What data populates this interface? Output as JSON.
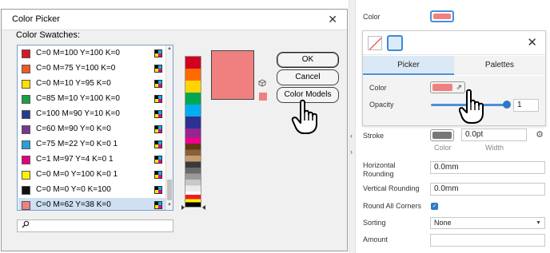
{
  "dialog": {
    "title": "Color Picker",
    "swatches_label": "Color Swatches:",
    "swatches": [
      {
        "label": "C=0 M=100 Y=100 K=0",
        "color": "#d7182a",
        "selected": false
      },
      {
        "label": "C=0 M=75 Y=100 K=0",
        "color": "#ee5a24",
        "selected": false
      },
      {
        "label": "C=0 M=10 Y=95 K=0",
        "color": "#fde100",
        "selected": false
      },
      {
        "label": "C=85 M=10 Y=100 K=0",
        "color": "#16a04a",
        "selected": false
      },
      {
        "label": "C=100 M=90 Y=10 K=0",
        "color": "#253b8f",
        "selected": false
      },
      {
        "label": "C=60 M=90 Y=0 K=0",
        "color": "#7c3591",
        "selected": false
      },
      {
        "label": "C=75 M=22 Y=0 K=0 1",
        "color": "#2b9fd9",
        "selected": false
      },
      {
        "label": "C=1 M=97 Y=4 K=0 1",
        "color": "#e3007e",
        "selected": false
      },
      {
        "label": "C=0 M=0 Y=100 K=0 1",
        "color": "#fff200",
        "selected": false
      },
      {
        "label": "C=0 M=0 Y=0 K=100",
        "color": "#111111",
        "selected": false
      },
      {
        "label": "C=0 M=62 Y=38 K=0",
        "color": "#f08080",
        "selected": true
      }
    ],
    "search_placeholder": "",
    "preview_color": "#f08080",
    "buttons": {
      "ok": "OK",
      "cancel": "Cancel",
      "color_models": "Color Models"
    }
  },
  "panel": {
    "color_label": "Color",
    "color_value": "#f08080",
    "popover": {
      "tabs": [
        "Picker",
        "Palettes"
      ],
      "active_tab": "Picker",
      "color_label": "Color",
      "opacity_label": "Opacity",
      "opacity_value": "1"
    },
    "stroke": {
      "label": "Stroke",
      "color_label": "Color",
      "width_label": "Width",
      "width_value": "0.0pt",
      "color": "#777777"
    },
    "horizontal_rounding": {
      "label_line1": "Horizontal",
      "label_line2": "Rounding",
      "value": "0.0mm"
    },
    "vertical_rounding": {
      "label": "Vertical Rounding",
      "value": "0.0mm"
    },
    "round_all_corners": {
      "label": "Round All Corners",
      "checked": true
    },
    "sorting": {
      "label": "Sorting",
      "value": "None"
    },
    "amount": {
      "label": "Amount",
      "value": ""
    }
  },
  "colors": {
    "accent": "#4a90d9",
    "salmon": "#f08080"
  },
  "icons": [
    "close-icon",
    "search-icon",
    "cube-icon",
    "no-color-icon",
    "solid-color-icon",
    "external-link-icon",
    "gear-icon",
    "chevron-left-icon",
    "chevron-right-icon",
    "checkmark-icon",
    "hand-cursor-icon"
  ]
}
